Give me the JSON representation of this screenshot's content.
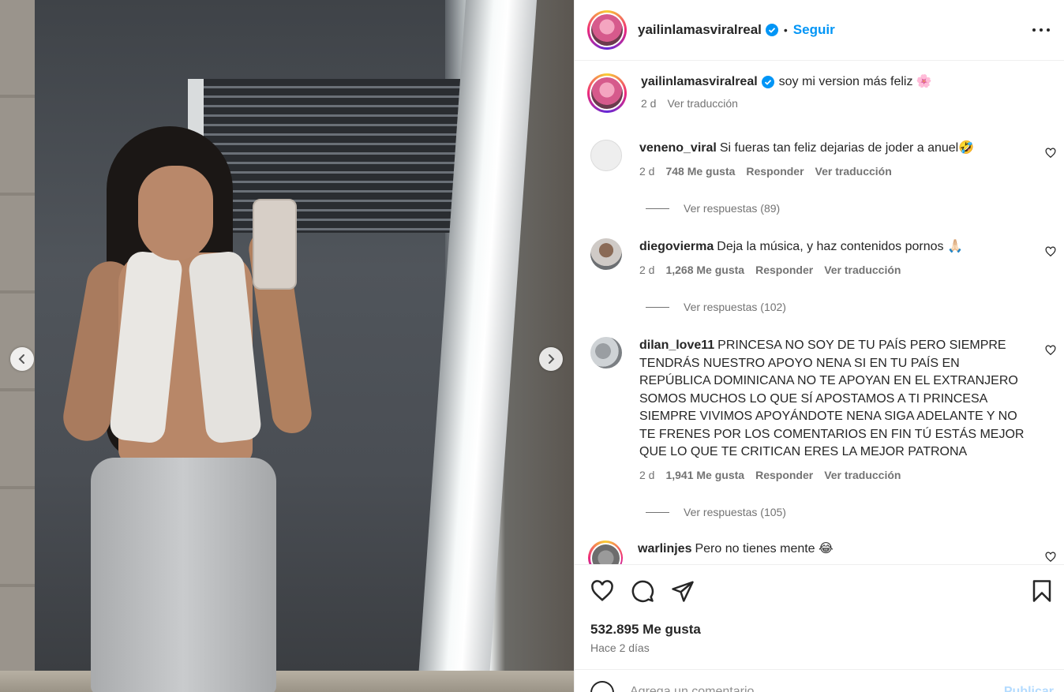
{
  "post": {
    "username": "yailinlamasviralreal",
    "follow_label": "Seguir",
    "separator": "•",
    "caption": "soy mi version más feliz 🌸",
    "caption_time": "2 d",
    "translate_label": "Ver traducción"
  },
  "comments": [
    {
      "username": "veneno_viral",
      "text": "Si fueras tan feliz dejarias de joder a anuel🤣",
      "time": "2 d",
      "likes": "748 Me gusta",
      "reply_label": "Responder",
      "translate_label": "Ver traducción",
      "replies": "Ver respuestas (89)"
    },
    {
      "username": "diegovierma",
      "text": "Deja la música, y haz contenidos pornos 🙏🏻",
      "time": "2 d",
      "likes": "1,268 Me gusta",
      "reply_label": "Responder",
      "translate_label": "Ver traducción",
      "replies": "Ver respuestas (102)"
    },
    {
      "username": "dilan_love11",
      "text": "PRINCESA NO SOY DE TU PAÍS PERO SIEMPRE TENDRÁS NUESTRO APOYO NENA SI EN TU PAÍS EN REPÚBLICA DOMINICANA NO TE APOYAN EN EL EXTRANJERO SOMOS MUCHOS LO QUE SÍ APOSTAMOS A TI PRINCESA SIEMPRE VIVIMOS APOYÁNDOTE NENA SIGA ADELANTE Y NO TE FRENES POR LOS COMENTARIOS EN FIN TÚ ESTÁS MEJOR QUE LO QUE TE CRITICAN ERES LA MEJOR PATRONA",
      "time": "2 d",
      "likes": "1,941 Me gusta",
      "reply_label": "Responder",
      "translate_label": "Ver traducción",
      "replies": "Ver respuestas (105)"
    },
    {
      "username": "warlinjes",
      "text": "Pero no tienes mente 😂"
    }
  ],
  "footer": {
    "likes": "532.895 Me gusta",
    "time": "Hace 2 días",
    "comment_placeholder": "Agrega un comentario...",
    "post_label": "Publicar"
  },
  "icons": {
    "verified": "verified-badge-icon",
    "more": "more-options-icon",
    "like": "heart-icon",
    "comment": "comment-icon",
    "share": "share-icon",
    "save": "bookmark-icon",
    "prev": "chevron-left-icon",
    "next": "chevron-right-icon",
    "emoji": "emoji-icon"
  },
  "colors": {
    "accent": "#0095f6",
    "verified": "#0095f6",
    "secondary_text": "#737373"
  }
}
